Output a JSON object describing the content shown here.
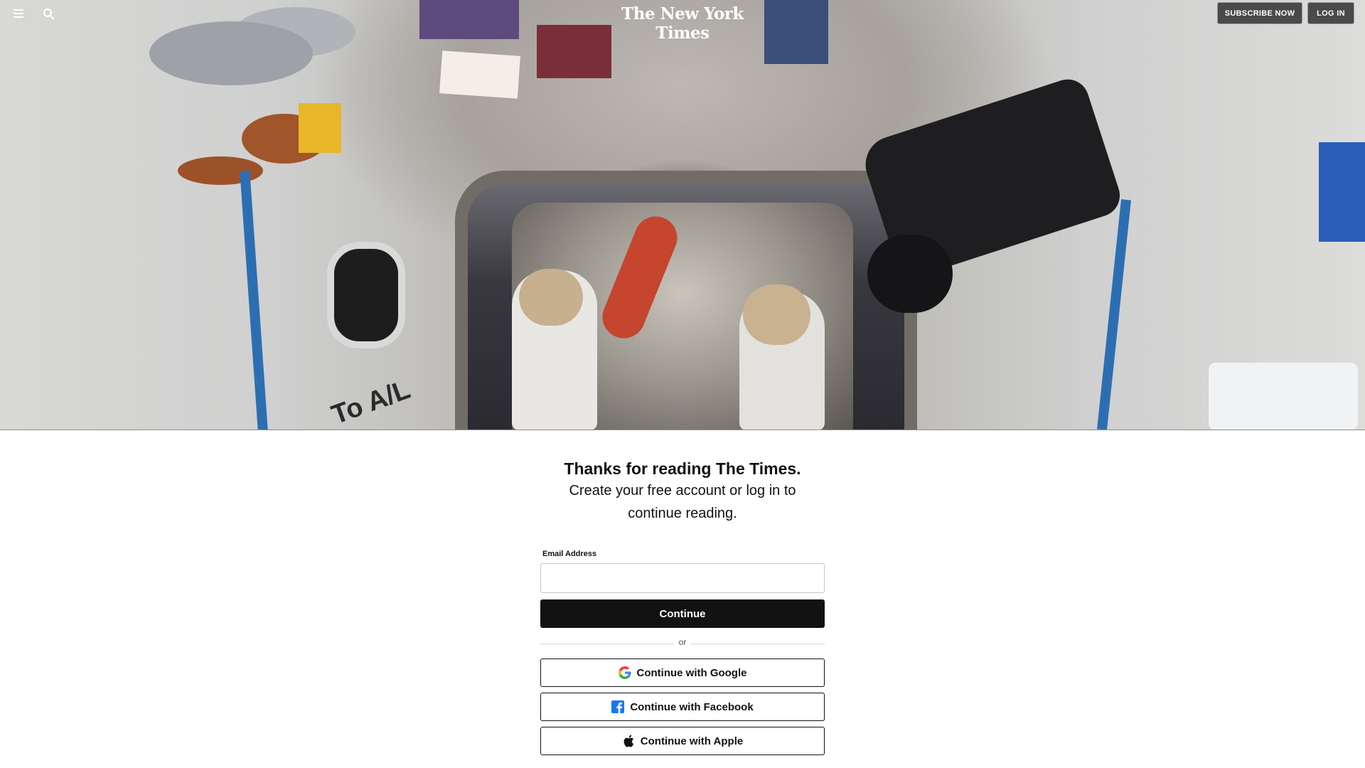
{
  "header": {
    "logo_text": "The New York Times",
    "subscribe_label": "SUBSCRIBE NOW",
    "login_label": "LOG IN",
    "menu_icon": "hamburger-menu-icon",
    "search_icon": "search-icon"
  },
  "hero": {
    "sign_text": "To A/L"
  },
  "paywall": {
    "headline": "Thanks for reading The Times.",
    "subhead": "Create your free account or log in to continue reading.",
    "email_label": "Email Address",
    "email_value": "",
    "continue_label": "Continue",
    "divider_text": "or",
    "google_label": "Continue with Google",
    "facebook_label": "Continue with Facebook",
    "apple_label": "Continue with Apple"
  },
  "colors": {
    "button_dark": "#121212",
    "google_blue": "#4285F4",
    "facebook_blue": "#1877F2"
  }
}
